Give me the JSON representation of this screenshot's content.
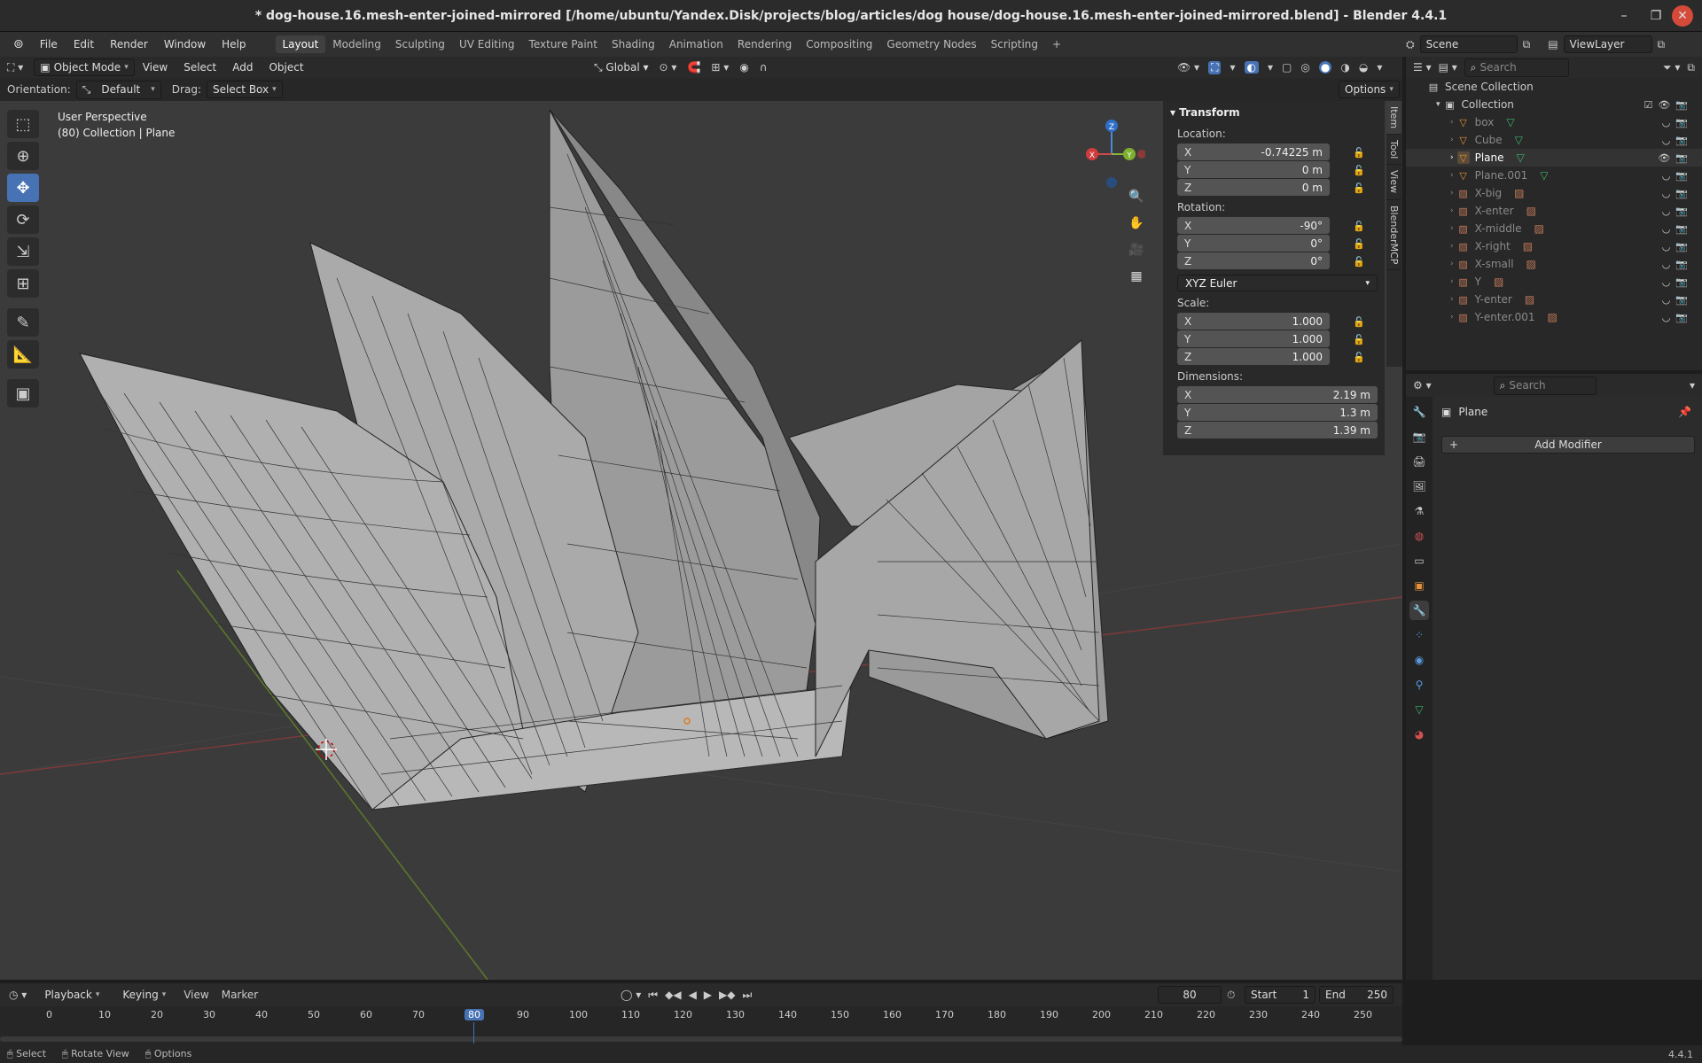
{
  "window": {
    "title": "* dog-house.16.mesh-enter-joined-mirrored [/home/ubuntu/Yandex.Disk/projects/blog/articles/dog house/dog-house.16.mesh-enter-joined-mirrored.blend] - Blender 4.4.1"
  },
  "topbar": {
    "menus": [
      "File",
      "Edit",
      "Render",
      "Window",
      "Help"
    ],
    "workspaces": [
      "Layout",
      "Modeling",
      "Sculpting",
      "UV Editing",
      "Texture Paint",
      "Shading",
      "Animation",
      "Rendering",
      "Compositing",
      "Geometry Nodes",
      "Scripting"
    ],
    "active_workspace": "Layout",
    "scene_label": "Scene",
    "viewlayer_label": "ViewLayer"
  },
  "viewport_header": {
    "mode": "Object Mode",
    "menus": [
      "View",
      "Select",
      "Add",
      "Object"
    ],
    "transform_space": "Global"
  },
  "tool_options": {
    "orientation_label": "Orientation:",
    "orientation_value": "Default",
    "drag_label": "Drag:",
    "drag_value": "Select Box",
    "options_label": "Options"
  },
  "viewport": {
    "perspective": "User Perspective",
    "context": "(80) Collection | Plane"
  },
  "npanel": {
    "header": "Transform",
    "location_label": "Location:",
    "location": [
      {
        "axis": "X",
        "value": "-0.74225 m"
      },
      {
        "axis": "Y",
        "value": "0 m"
      },
      {
        "axis": "Z",
        "value": "0 m"
      }
    ],
    "rotation_label": "Rotation:",
    "rotation": [
      {
        "axis": "X",
        "value": "-90°"
      },
      {
        "axis": "Y",
        "value": "0°"
      },
      {
        "axis": "Z",
        "value": "0°"
      }
    ],
    "rotation_mode": "XYZ Euler",
    "scale_label": "Scale:",
    "scale": [
      {
        "axis": "X",
        "value": "1.000"
      },
      {
        "axis": "Y",
        "value": "1.000"
      },
      {
        "axis": "Z",
        "value": "1.000"
      }
    ],
    "dimensions_label": "Dimensions:",
    "dimensions": [
      {
        "axis": "X",
        "value": "2.19 m"
      },
      {
        "axis": "Y",
        "value": "1.3 m"
      },
      {
        "axis": "Z",
        "value": "1.39 m"
      }
    ],
    "tabs": [
      "Item",
      "Tool",
      "View",
      "BlenderMCP"
    ]
  },
  "gizmo": {
    "x": "X",
    "y": "Y",
    "z": "Z"
  },
  "outliner": {
    "search_placeholder": "Search",
    "scene_collection": "Scene Collection",
    "collection": "Collection",
    "items": [
      "box",
      "Cube",
      "Plane",
      "Plane.001",
      "X-big",
      "X-enter",
      "X-middle",
      "X-right",
      "X-small",
      "Y",
      "Y-enter",
      "Y-enter.001"
    ]
  },
  "properties": {
    "search_placeholder": "Search",
    "object_name": "Plane",
    "add_modifier": "Add Modifier"
  },
  "timeline": {
    "menus": [
      "Playback",
      "Keying",
      "View",
      "Marker"
    ],
    "current_frame": "80",
    "start_label": "Start",
    "start": "1",
    "end_label": "End",
    "end": "250",
    "ticks": [
      "0",
      "10",
      "20",
      "30",
      "40",
      "50",
      "60",
      "70",
      "80",
      "90",
      "100",
      "110",
      "120",
      "130",
      "140",
      "150",
      "160",
      "170",
      "180",
      "190",
      "200",
      "210",
      "220",
      "230",
      "240",
      "250"
    ]
  },
  "statusbar": {
    "items": [
      "Select",
      "Rotate View",
      "Options"
    ],
    "version": "4.4.1"
  }
}
